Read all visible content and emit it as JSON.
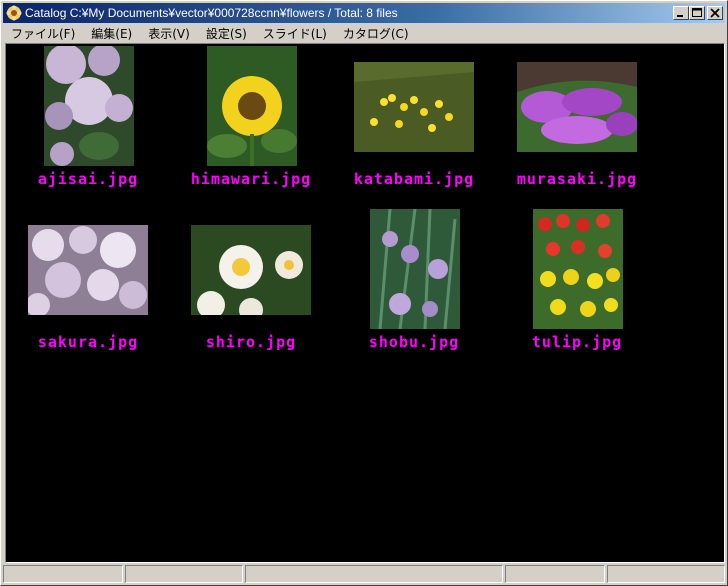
{
  "window": {
    "title": "Catalog  C:¥My Documents¥vector¥000728ccnn¥flowers / Total: 8 files",
    "icon": "flower-app-icon",
    "controls": [
      "minimize-icon",
      "maximize-icon",
      "close-icon"
    ]
  },
  "menu": [
    {
      "label": "ファイル(F)"
    },
    {
      "label": "編集(E)"
    },
    {
      "label": "表示(V)"
    },
    {
      "label": "設定(S)"
    },
    {
      "label": "スライド(L)"
    },
    {
      "label": "カタログ(C)"
    }
  ],
  "thumbnails": [
    {
      "name": "ajisai.jpg",
      "image": "hydrangea-photo"
    },
    {
      "name": "himawari.jpg",
      "image": "sunflower-photo"
    },
    {
      "name": "katabami.jpg",
      "image": "yellow-wildflowers-photo"
    },
    {
      "name": "murasaki.jpg",
      "image": "purple-flowers-photo"
    },
    {
      "name": "sakura.jpg",
      "image": "cherry-blossom-photo"
    },
    {
      "name": "shiro.jpg",
      "image": "daffodil-photo"
    },
    {
      "name": "shobu.jpg",
      "image": "iris-photo"
    },
    {
      "name": "tulip.jpg",
      "image": "tulip-photo"
    }
  ],
  "colors": {
    "caption": "#ff00ff",
    "background": "#000000",
    "titlebar": "#0a246a"
  },
  "status": [
    "",
    "",
    "",
    "",
    ""
  ]
}
